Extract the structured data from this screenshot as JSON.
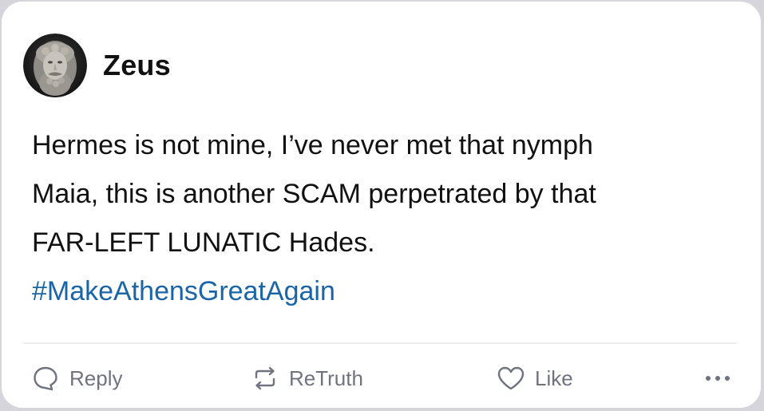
{
  "post": {
    "author": "Zeus",
    "avatar_icon": "zeus-statue-avatar",
    "text_lines": [
      "Hermes is not mine, I’ve never met that nymph",
      "Maia, this is another SCAM perpetrated by that",
      "FAR-LEFT LUNATIC Hades."
    ],
    "hashtag": "#MakeAthensGreatAgain"
  },
  "actions": {
    "reply": {
      "label": "Reply",
      "icon": "speech-bubble-icon"
    },
    "retruth": {
      "label": "ReTruth",
      "icon": "repost-arrows-icon"
    },
    "like": {
      "label": "Like",
      "icon": "heart-icon"
    },
    "more": {
      "icon": "more-dots-icon"
    }
  },
  "colors": {
    "hashtag": "#1a64a8",
    "action_gray": "#707280",
    "text": "#111111",
    "card_bg": "#ffffff"
  }
}
